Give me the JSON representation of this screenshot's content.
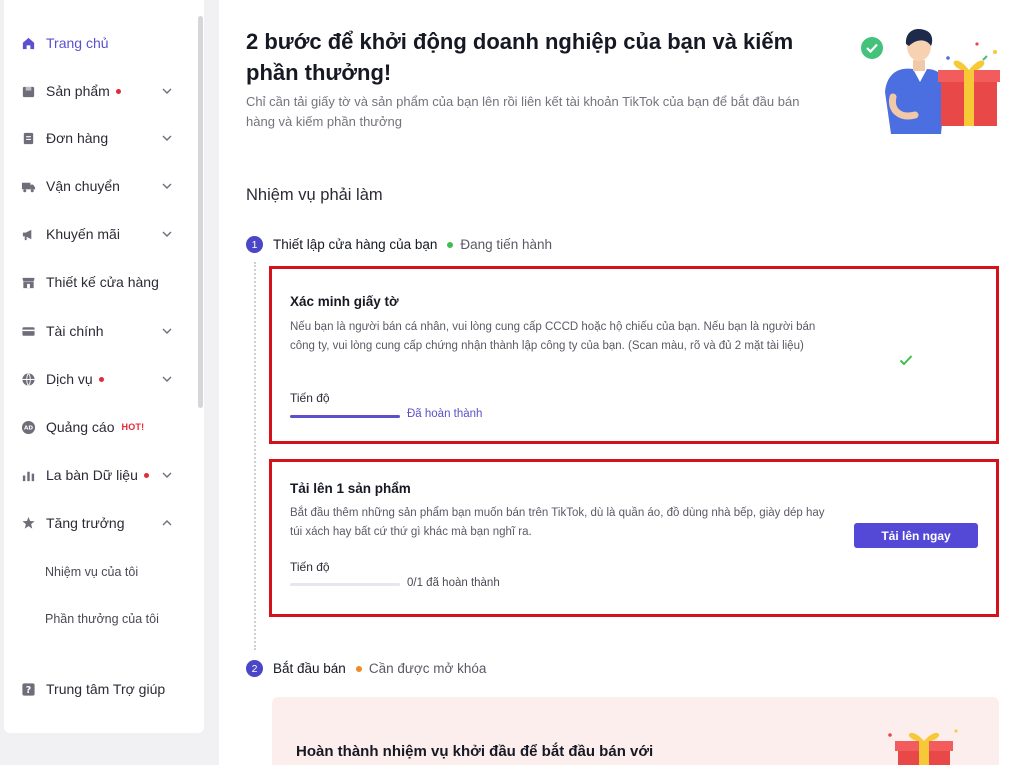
{
  "sidebar": {
    "items": [
      {
        "label": "Trang chủ",
        "icon": "home-icon"
      },
      {
        "label": "Sản phẩm",
        "icon": "box-icon"
      },
      {
        "label": "Đơn hàng",
        "icon": "order-icon"
      },
      {
        "label": "Vận chuyển",
        "icon": "truck-icon"
      },
      {
        "label": "Khuyến mãi",
        "icon": "megaphone-icon"
      },
      {
        "label": "Thiết kế cửa hàng",
        "icon": "store-icon"
      },
      {
        "label": "Tài chính",
        "icon": "card-icon"
      },
      {
        "label": "Dịch vụ",
        "icon": "globe-icon"
      },
      {
        "label": "Quảng cáo",
        "icon": "ad-icon",
        "badge": "HOT!"
      },
      {
        "label": "La bàn Dữ liệu",
        "icon": "chart-icon"
      },
      {
        "label": "Tăng trưởng",
        "icon": "growth-icon"
      },
      {
        "label": "Trung tâm Trợ giúp",
        "icon": "help-icon"
      }
    ],
    "sub_items": [
      "Nhiệm vụ của tôi",
      "Phần thưởng của tôi"
    ]
  },
  "main": {
    "headline": "2 bước để khởi động doanh nghiệp của bạn và kiếm phần thưởng!",
    "subline": "Chỉ cần tải giấy tờ và sản phẩm của bạn lên rồi liên kết tài khoản TikTok của bạn để bắt đầu bán hàng và kiếm phần thưởng",
    "section_title": "Nhiệm vụ phải làm",
    "steps": [
      {
        "number": "1",
        "title": "Thiết lập cửa hàng của bạn",
        "status": "Đang tiến hành",
        "status_color": "#3fbf4a"
      },
      {
        "number": "2",
        "title": "Bắt đầu bán",
        "status": "Cần được mở khóa",
        "status_color": "#f08a24"
      }
    ],
    "tasks": [
      {
        "title": "Xác minh giấy tờ",
        "desc": "Nếu bạn là người bán cá nhân, vui lòng cung cấp CCCD hoặc hộ chiếu của bạn. Nếu bạn là người bán công ty, vui lòng cung cấp chứng nhận thành lập công ty của bạn. (Scan màu, rõ và đủ 2 mặt tài liệu)",
        "progress_label": "Tiến độ",
        "progress_text": "Đã hoàn thành",
        "progress_fraction": 1.0
      },
      {
        "title": "Tải lên 1 sản phẩm",
        "desc": "Bắt đầu thêm những sản phẩm bạn muốn bán trên TikTok, dù là quần áo, đồ dùng nhà bếp, giày dép hay túi xách hay bất cứ thứ gì khác mà bạn nghĩ ra.",
        "progress_label": "Tiến độ",
        "progress_text": "0/1 đã hoàn thành",
        "progress_fraction": 0.0,
        "button_label": "Tải lên ngay"
      }
    ],
    "promo_text": "Hoàn thành nhiệm vụ khởi đầu để bắt đầu bán với"
  },
  "colors": {
    "accent": "#5449d6",
    "highlight_border": "#d3121b",
    "check": "#3fbf4a"
  }
}
